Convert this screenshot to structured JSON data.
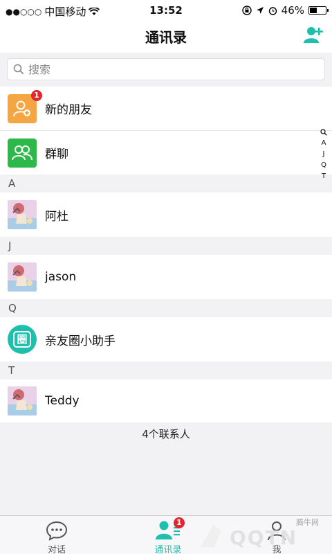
{
  "status": {
    "carrier": "中国移动",
    "time": "13:52",
    "battery": "46%",
    "battery_level": 0.46
  },
  "nav": {
    "title": "通讯录"
  },
  "search": {
    "placeholder": "搜索"
  },
  "top_items": [
    {
      "label": "新的朋友",
      "badge": "1"
    },
    {
      "label": "群聊"
    }
  ],
  "sections": [
    {
      "letter": "A",
      "contacts": [
        {
          "name": "阿杜"
        }
      ]
    },
    {
      "letter": "J",
      "contacts": [
        {
          "name": "jason"
        }
      ]
    },
    {
      "letter": "Q",
      "contacts": [
        {
          "name": "亲友圈小助手",
          "icon_char": "圈"
        }
      ]
    },
    {
      "letter": "T",
      "contacts": [
        {
          "name": "Teddy"
        }
      ]
    }
  ],
  "index_bar": [
    "A",
    "J",
    "Q",
    "T"
  ],
  "footer": {
    "count_text": "4个联系人"
  },
  "tabs": [
    {
      "label": "对话"
    },
    {
      "label": "通讯录",
      "badge": "1"
    },
    {
      "label": "我"
    }
  ],
  "watermark": {
    "logo_text": "QQTN",
    "site_text": "腾牛网"
  },
  "colors": {
    "accent": "#1fbfad",
    "new_friend_icon": "#f5a542",
    "group_chat_icon": "#2db84a",
    "badge": "#e0262e"
  }
}
